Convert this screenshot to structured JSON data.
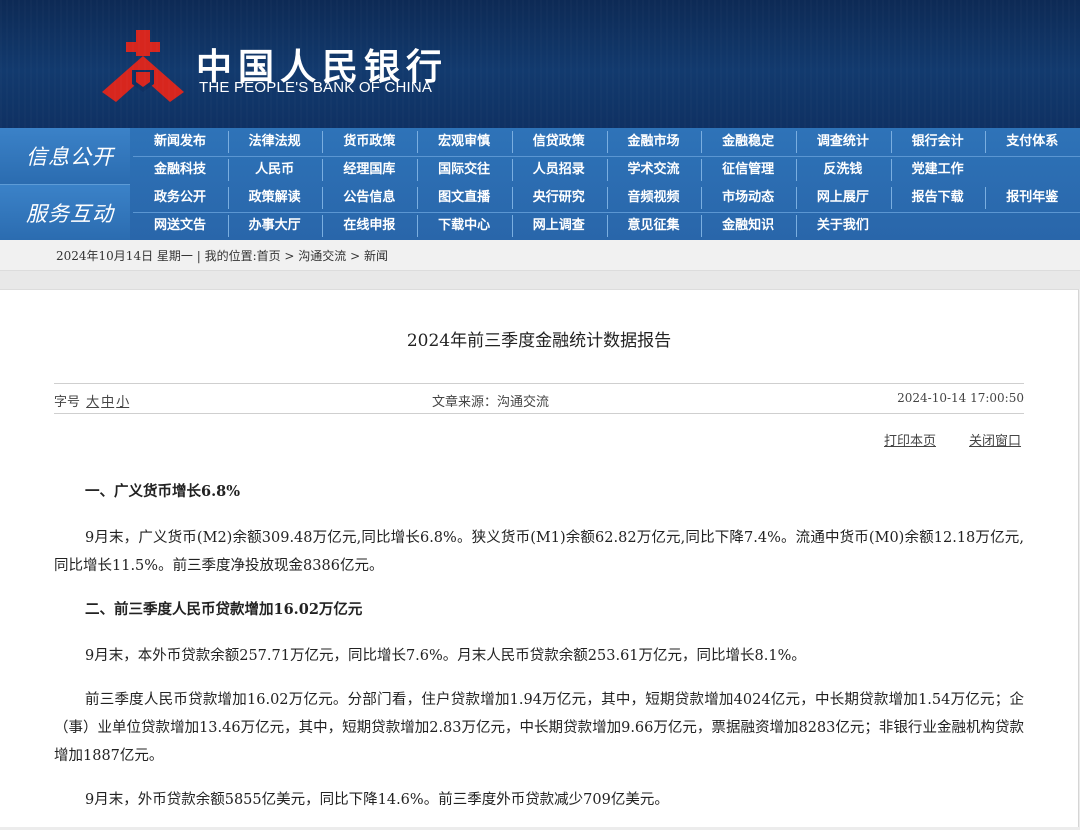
{
  "header": {
    "name_cn": "中国人民银行",
    "name_en": "THE PEOPLE'S BANK OF CHINA",
    "brand_color": "#d7261e"
  },
  "nav": {
    "group1": "信息公开",
    "group2": "服务互动",
    "rows": [
      [
        "新闻发布",
        "法律法规",
        "货币政策",
        "宏观审慎",
        "信贷政策",
        "金融市场",
        "金融稳定",
        "调查统计",
        "银行会计",
        "支付体系"
      ],
      [
        "金融科技",
        "人民币",
        "经理国库",
        "国际交往",
        "人员招录",
        "学术交流",
        "征信管理",
        "反洗钱",
        "党建工作"
      ],
      [
        "政务公开",
        "政策解读",
        "公告信息",
        "图文直播",
        "央行研究",
        "音频视频",
        "市场动态",
        "网上展厅",
        "报告下载",
        "报刊年鉴"
      ],
      [
        "网送文告",
        "办事大厅",
        "在线申报",
        "下载中心",
        "网上调查",
        "意见征集",
        "金融知识",
        "关于我们"
      ]
    ]
  },
  "breadcrumb": "2024年10月14日 星期一 | 我的位置:首页 > 沟通交流 > 新闻",
  "article": {
    "title": "2024年前三季度金融统计数据报告",
    "font_size_label": "字号",
    "font_sizes": [
      "大",
      "中",
      "小"
    ],
    "source": "文章来源：沟通交流",
    "date": "2024-10-14 17:00:50",
    "print_label": "打印本页",
    "close_label": "关闭窗口",
    "h1": "一、广义货币增长6.8%",
    "p1": "9月末，广义货币(M2)余额309.48万亿元,同比增长6.8%。狭义货币(M1)余额62.82万亿元,同比下降7.4%。流通中货币(M0)余额12.18万亿元,同比增长11.5%。前三季度净投放现金8386亿元。",
    "h2": "二、前三季度人民币贷款增加16.02万亿元",
    "p2": "9月末，本外币贷款余额257.71万亿元，同比增长7.6%。月末人民币贷款余额253.61万亿元，同比增长8.1%。",
    "p3": "前三季度人民币贷款增加16.02万亿元。分部门看，住户贷款增加1.94万亿元，其中，短期贷款增加4024亿元，中长期贷款增加1.54万亿元；企（事）业单位贷款增加13.46万亿元，其中，短期贷款增加2.83万亿元，中长期贷款增加9.66万亿元，票据融资增加8283亿元；非银行业金融机构贷款增加1887亿元。",
    "p4": "9月末，外币贷款余额5855亿美元，同比下降14.6%。前三季度外币贷款减少709亿美元。"
  }
}
